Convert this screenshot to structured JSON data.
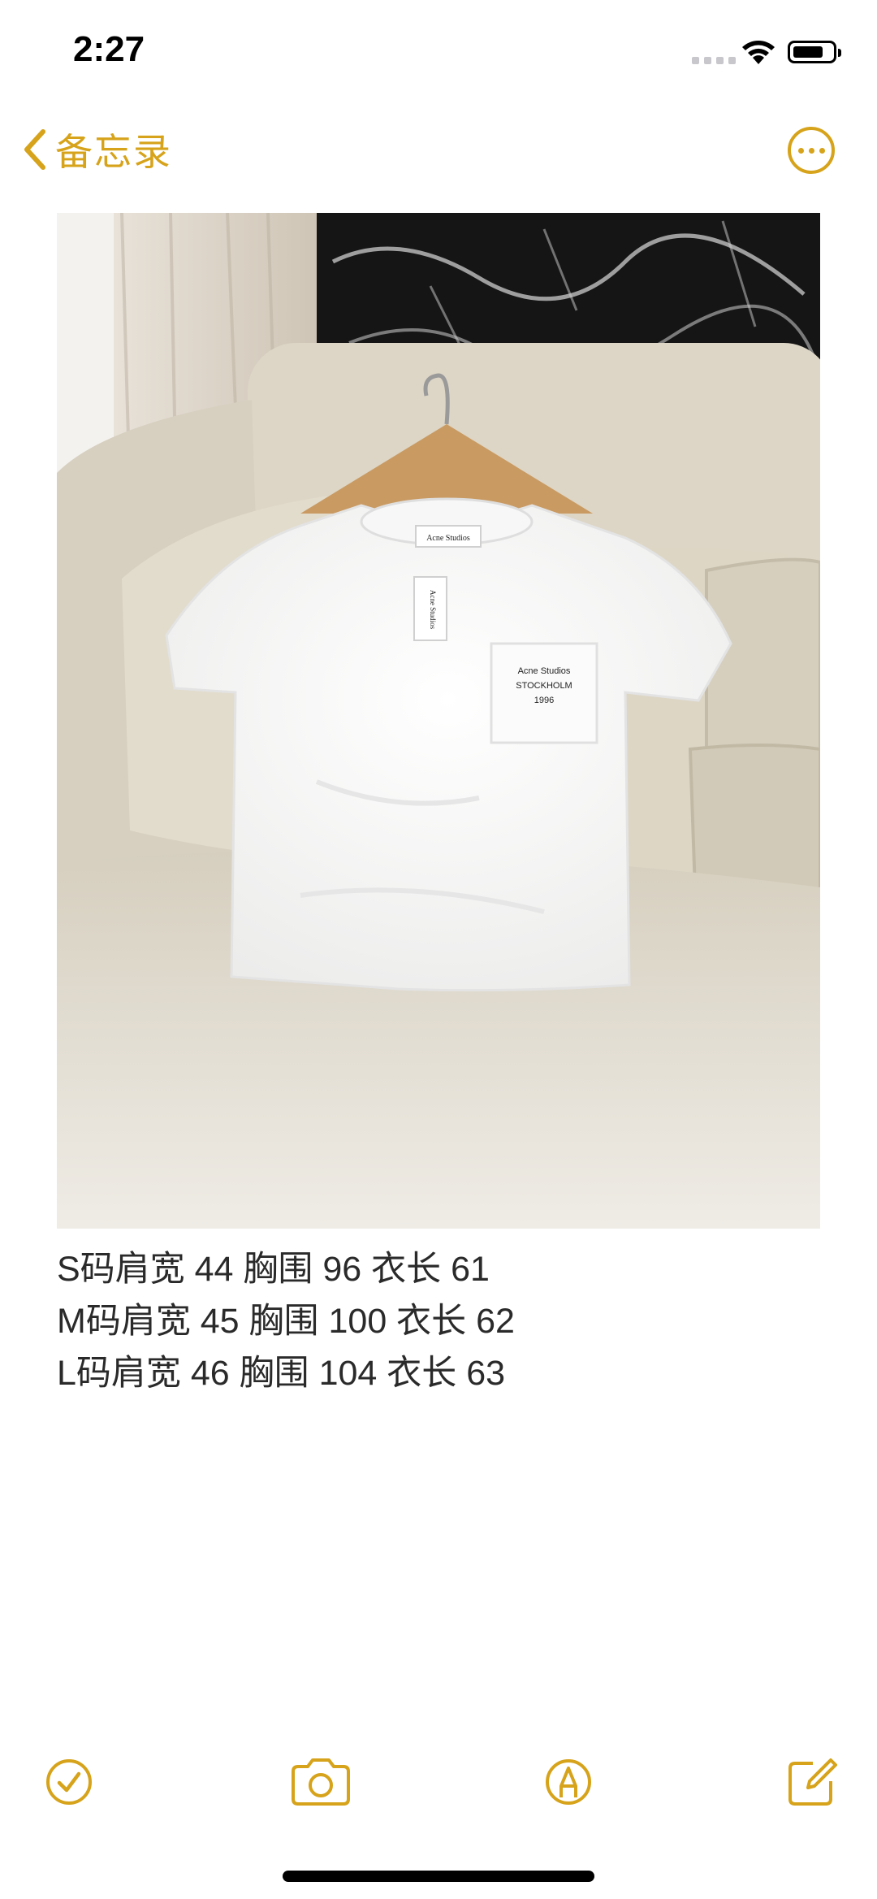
{
  "status_bar": {
    "time": "2:27"
  },
  "nav": {
    "back_label": "备忘录"
  },
  "note": {
    "lines": [
      "S码肩宽 44 胸围 96 衣长 61",
      "M码肩宽 45 胸围 100 衣长 62",
      "L码肩宽 46 胸围 104 衣长 63"
    ]
  },
  "photo": {
    "shirt_pocket_text": [
      "Acne Studios",
      "STOCKHOLM",
      "1996"
    ],
    "neck_label_text": "Acne Studios",
    "hang_tag_text": "Acne Studios"
  },
  "icons": {
    "back": "chevron-left-icon",
    "more": "ellipsis-circle-icon",
    "checklist": "checkmark-circle-icon",
    "camera": "camera-icon",
    "markup": "pen-circle-icon",
    "compose": "compose-icon"
  },
  "colors": {
    "accent": "#d6a31a",
    "text": "#2a2a2a"
  }
}
